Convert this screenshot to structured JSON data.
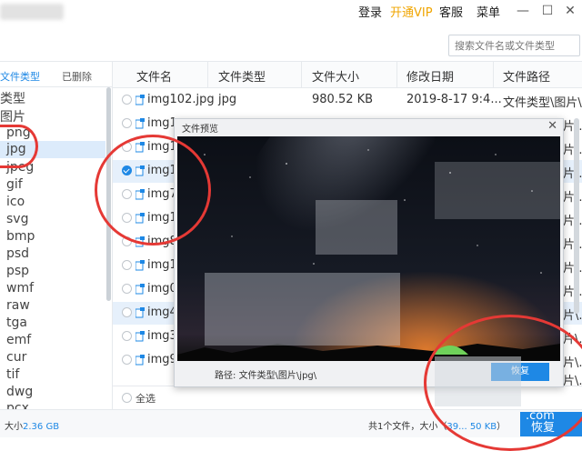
{
  "titlebar": {
    "login": "登录",
    "vip": "开通VIP",
    "service": "客服",
    "menu": "菜单",
    "minimize": "—",
    "maximize": "☐",
    "close": "✕"
  },
  "search": {
    "placeholder": "搜索文件名或文件类型"
  },
  "left": {
    "tab_types": "文件类型",
    "tab_deleted": "已删除",
    "tree": [
      "类型",
      "图片",
      "png",
      "jpg",
      "jpeg",
      "gif",
      "ico",
      "svg",
      "bmp",
      "psd",
      "psp",
      "wmf",
      "raw",
      "tga",
      "emf",
      "cur",
      "tif",
      "dwg",
      "pcx"
    ],
    "selected": "jpg"
  },
  "table": {
    "headers": {
      "name": "文件名",
      "type": "文件类型",
      "size": "文件大小",
      "date": "修改日期",
      "path": "文件路径"
    },
    "rows": [
      {
        "name": "img102.jpg",
        "type": "jpg",
        "size": "980.52 KB",
        "date": "2019-8-17 9:4...",
        "path": "文件类型\\图片\\..."
      },
      {
        "name": "img1",
        "path": "片\\.."
      },
      {
        "name": "img1",
        "path": "片\\.."
      },
      {
        "name": "img1",
        "path": "片\\.."
      },
      {
        "name": "img7",
        "path": "片\\.."
      },
      {
        "name": "img1",
        "path": "片\\.."
      },
      {
        "name": "img8",
        "path": "片\\.."
      },
      {
        "name": "img1",
        "path": "片\\.."
      },
      {
        "name": "img0",
        "path": "片\\.."
      },
      {
        "name": "img4",
        "path": "片\\.."
      },
      {
        "name": "img3",
        "path": "片\\.."
      },
      {
        "name": "img9",
        "path": "片\\.."
      },
      {
        "name": "",
        "path": "片\\.."
      }
    ]
  },
  "select_all": "全选",
  "status": {
    "size_label": "大小",
    "size_value": "2.36 GB",
    "summary_prefix": "共1个文件，大小（",
    "summary_value": "39... 50 KB",
    "summary_suffix": "）",
    "recover": "恢复",
    "watermark": ".com"
  },
  "preview": {
    "title": "文件预览",
    "close": "✕",
    "path_label": "路径:",
    "path_value": "文件类型\\图片\\jpg\\",
    "button": "恢复"
  },
  "colors": {
    "accent": "#1e88e5",
    "vip": "#f0a500",
    "annotation": "#e53935"
  }
}
